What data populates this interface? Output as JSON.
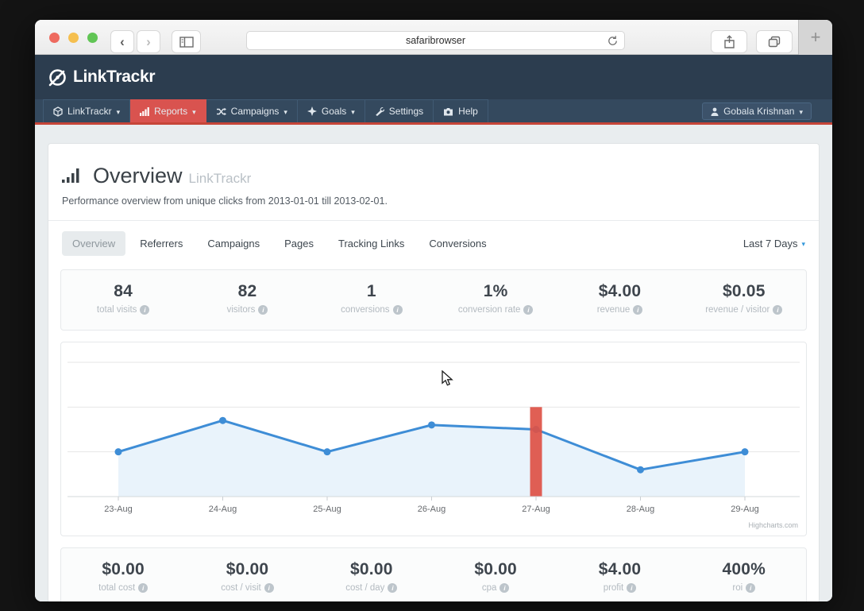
{
  "browser": {
    "url": "safaribrowser",
    "new_tab_glyph": "+",
    "back_glyph": "‹",
    "forward_glyph": "›"
  },
  "brand": {
    "name": "LinkTrackr"
  },
  "nav": {
    "items": [
      {
        "label": "LinkTrackr",
        "caret": "▾"
      },
      {
        "label": "Reports",
        "caret": "▾"
      },
      {
        "label": "Campaigns",
        "caret": "▾"
      },
      {
        "label": "Goals",
        "caret": "▾"
      },
      {
        "label": "Settings",
        "caret": ""
      },
      {
        "label": "Help",
        "caret": ""
      }
    ],
    "active_item": "Reports",
    "user": {
      "name": "Gobala Krishnan",
      "caret": "▾"
    }
  },
  "page": {
    "title": "Overview",
    "title_suffix": "LinkTrackr",
    "subtitle": "Performance overview from unique clicks from 2013-01-01 till 2013-02-01."
  },
  "tabs": {
    "items": [
      "Overview",
      "Referrers",
      "Campaigns",
      "Pages",
      "Tracking Links",
      "Conversions"
    ],
    "active": "Overview",
    "range_label": "Last 7 Days",
    "range_caret": "▾"
  },
  "stats_top": [
    {
      "value": "84",
      "label": "total visits"
    },
    {
      "value": "82",
      "label": "visitors"
    },
    {
      "value": "1",
      "label": "conversions"
    },
    {
      "value": "1%",
      "label": "conversion rate"
    },
    {
      "value": "$4.00",
      "label": "revenue"
    },
    {
      "value": "$0.05",
      "label": "revenue / visitor"
    }
  ],
  "stats_bottom": [
    {
      "value": "$0.00",
      "label": "total cost"
    },
    {
      "value": "$0.00",
      "label": "cost / visit"
    },
    {
      "value": "$0.00",
      "label": "cost / day"
    },
    {
      "value": "$0.00",
      "label": "cpa"
    },
    {
      "value": "$4.00",
      "label": "profit"
    },
    {
      "value": "400%",
      "label": "roi"
    }
  ],
  "info_glyph": "i",
  "chart_data": {
    "type": "line",
    "title": "",
    "categories": [
      "23-Aug",
      "24-Aug",
      "25-Aug",
      "26-Aug",
      "27-Aug",
      "28-Aug",
      "29-Aug"
    ],
    "series": [
      {
        "name": "unique clicks",
        "values": [
          10,
          17,
          10,
          16,
          15,
          6,
          10
        ]
      }
    ],
    "ylim": [
      0,
      30
    ],
    "y_step": 10,
    "y_labels_visible": false,
    "grid": true,
    "legend": "none",
    "annotation_bar": {
      "category": "27-Aug",
      "value": 20,
      "color": "#dd5145"
    },
    "credit": "Highcharts.com",
    "colors": {
      "line": "#3e8dd6",
      "marker": "#3e8dd6",
      "area_fill": "#e9f3fb",
      "grid": "#e6e6e6",
      "axis": "#d3d8db",
      "tick": "#c9ced2",
      "label": "#66696d"
    }
  },
  "theme": {
    "brand_navy": "#2c3d4f",
    "nav_navy": "#34495e",
    "accent_red": "#d9534f",
    "underline_red": "#c64538",
    "link_blue": "#3498db",
    "page_bg": "#e9edef"
  }
}
